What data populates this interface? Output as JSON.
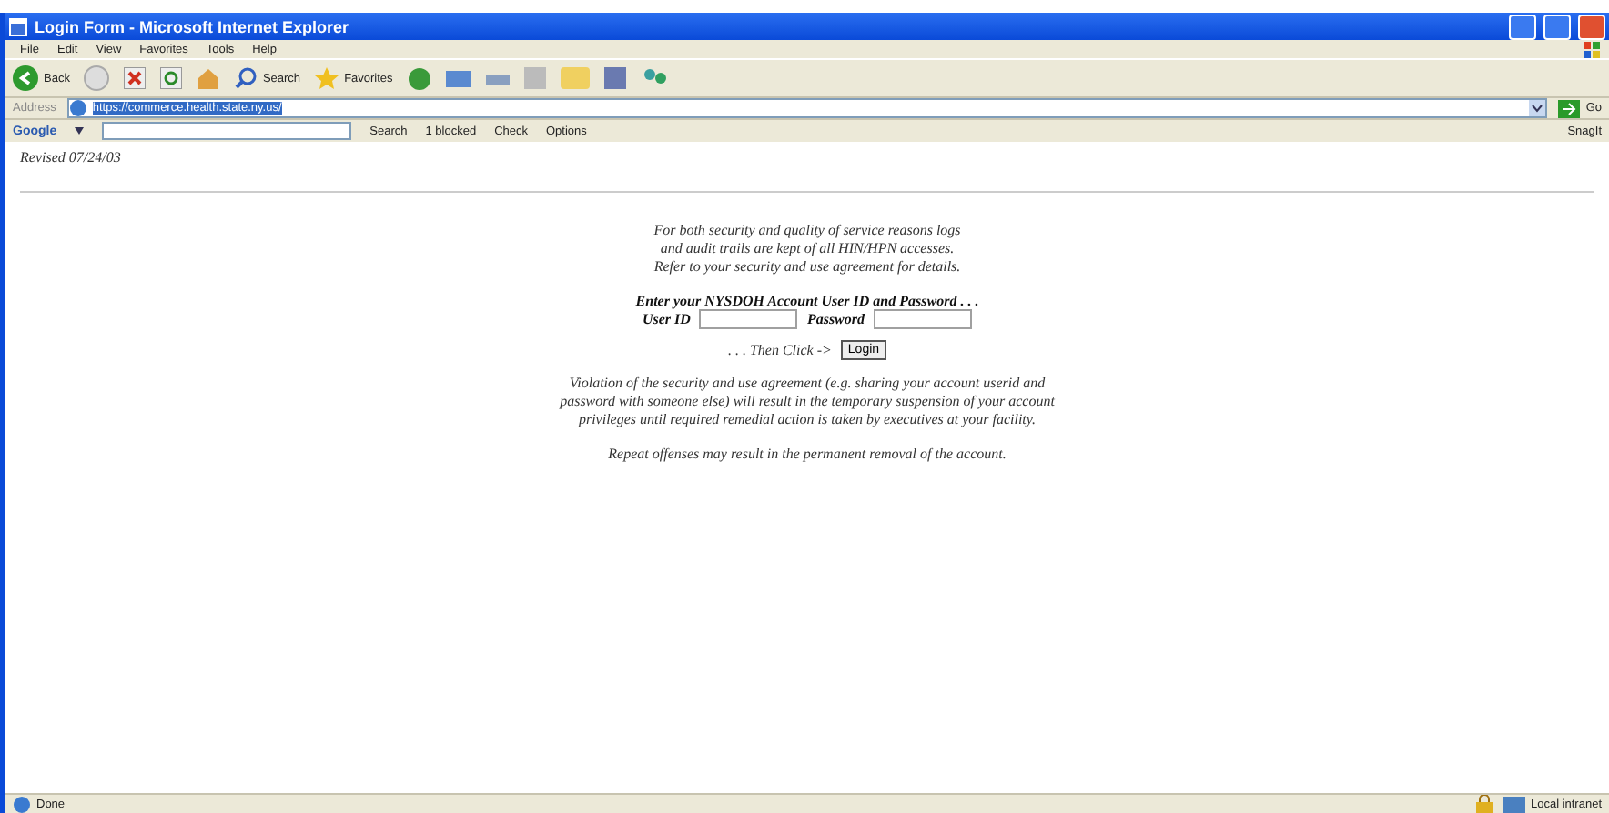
{
  "window": {
    "title": "Login Form - Microsoft Internet Explorer"
  },
  "menu": [
    "File",
    "Edit",
    "View",
    "Favorites",
    "Tools",
    "Help"
  ],
  "toolbar": {
    "back": "Back",
    "search": "Search",
    "favorites": "Favorites"
  },
  "address": {
    "label": "Address",
    "url": "https://commerce.health.state.ny.us/",
    "go": "Go"
  },
  "google_toolbar": {
    "logo": "Google",
    "search": "Search",
    "blocked": "1 blocked",
    "check": "Check",
    "options": "Options",
    "snagit": "SnagIt"
  },
  "page": {
    "revised": "Revised 07/24/03",
    "notice": [
      "For both security and quality of service reasons logs",
      "and audit trails are kept of all HIN/HPN accesses.",
      "Refer to your security and use agreement for details."
    ],
    "prompt": "Enter your NYSDOH Account User ID and Password . . .",
    "user_label": "User ID",
    "password_label": "Password",
    "then_click": ". . . Then Click ->",
    "login": "Login",
    "violation": [
      "Violation of the security and use agreement (e.g. sharing your account userid and",
      "password with someone else) will result in the temporary suspension of your account",
      "privileges until required remedial action is taken by executives at your facility."
    ],
    "repeat": "Repeat offenses may result in the permanent removal of the account."
  },
  "status_bar": {
    "text": "Done",
    "zone": "Local intranet"
  }
}
